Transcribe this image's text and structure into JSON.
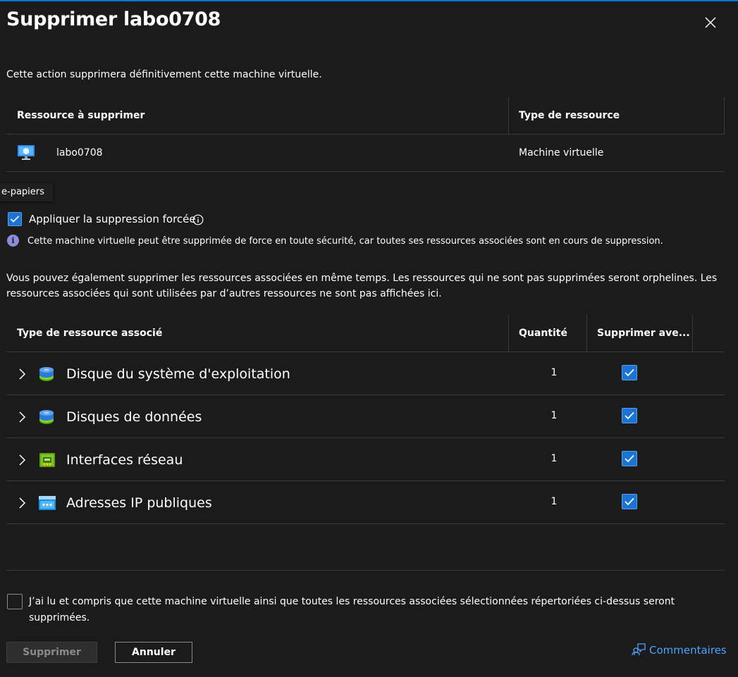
{
  "dialog": {
    "title": "Supprimer labo0708",
    "description": "Cette action supprimera définitivement cette machine virtuelle."
  },
  "resource_table": {
    "headers": [
      "Ressource à supprimer",
      "Type de ressource"
    ],
    "rows": [
      {
        "name": "labo0708",
        "type": "Machine virtuelle",
        "icon": "virtual-machine-icon"
      }
    ]
  },
  "tooltip_fragment": "e-papiers",
  "force_delete": {
    "label": "Appliquer la suppression forcée",
    "checked": true,
    "info_message": "Cette machine virtuelle peut être supprimée de force en toute sécurité, car toutes ses ressources associées sont en cours de suppression."
  },
  "associated_description": "Vous pouvez également supprimer les ressources associées en même temps. Les ressources qui ne sont pas supprimées seront orphelines. Les ressources associées qui sont utilisées par d’autres ressources ne sont pas affichées ici.",
  "associated_table": {
    "headers": [
      "Type de ressource associé",
      "Quantité",
      "Supprimer ave..."
    ],
    "rows": [
      {
        "label": "Disque du système d'exploitation",
        "quantity": "1",
        "checked": true,
        "icon": "disk-icon"
      },
      {
        "label": "Disques de données",
        "quantity": "1",
        "checked": true,
        "icon": "disk-icon"
      },
      {
        "label": "Interfaces réseau",
        "quantity": "1",
        "checked": true,
        "icon": "network-interface-icon"
      },
      {
        "label": "Adresses IP publiques",
        "quantity": "1",
        "checked": true,
        "icon": "public-ip-icon"
      }
    ]
  },
  "acknowledgement": {
    "label": "J’ai lu et compris que cette machine virtuelle ainsi que toutes les ressources associées sélectionnées répertoriées ci-dessus seront supprimées.",
    "checked": false
  },
  "footer": {
    "delete_label": "Supprimer",
    "cancel_label": "Annuler",
    "feedback_label": "Commentaires"
  },
  "colors": {
    "accent": "#1b74d4",
    "link": "#4da3ff",
    "info": "#8e8cd8",
    "background": "#1b1b1b"
  }
}
